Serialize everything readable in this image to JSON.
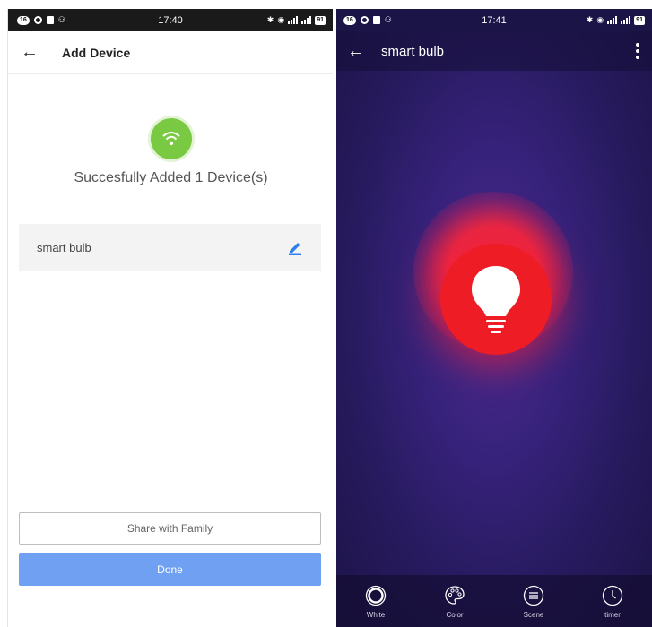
{
  "left": {
    "status_bar": {
      "time": "17:40",
      "badge": "16",
      "battery": "91"
    },
    "header": {
      "title": "Add Device"
    },
    "success_message": "Succesfully Added 1 Device(s)",
    "device": {
      "name": "smart bulb"
    },
    "share_button": "Share with Family",
    "done_button": "Done"
  },
  "right": {
    "status_bar": {
      "time": "17:41",
      "badge": "16",
      "battery": "91"
    },
    "header": {
      "title": "smart bulb"
    },
    "bulb_color": "#ee1c25",
    "tabs": [
      {
        "label": "White",
        "icon": "ring-icon"
      },
      {
        "label": "Color",
        "icon": "palette-icon"
      },
      {
        "label": "Scene",
        "icon": "scene-list-icon"
      },
      {
        "label": "timer",
        "icon": "clock-icon"
      }
    ]
  },
  "colors": {
    "success_green": "#7ac943",
    "done_blue": "#6fa0f2",
    "bulb_red": "#ee1c25",
    "edit_blue": "#2f7ef0"
  }
}
